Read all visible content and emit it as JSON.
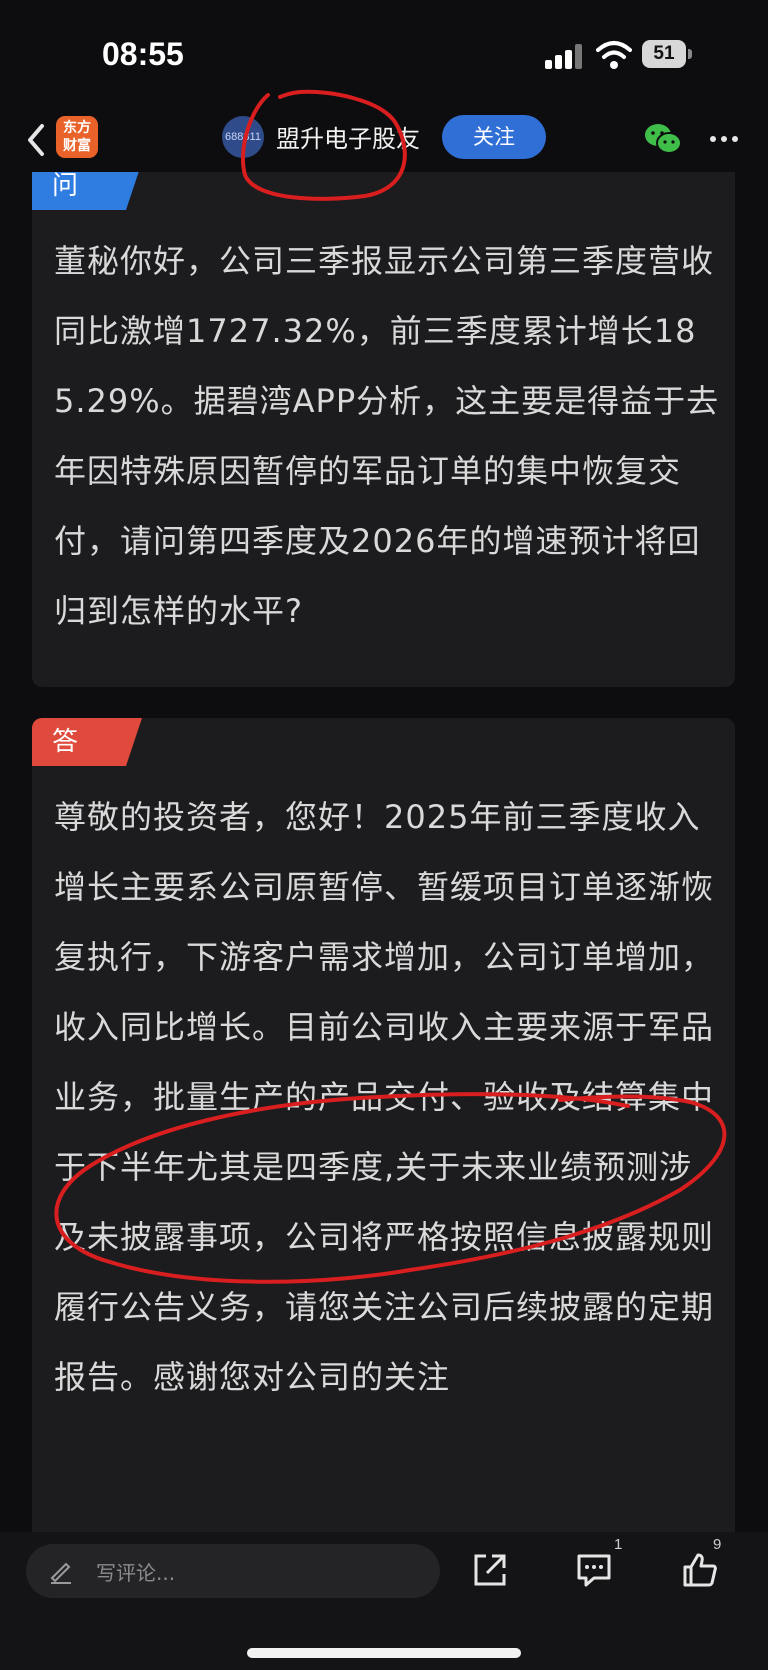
{
  "status_bar": {
    "time": "08:55",
    "battery": "51"
  },
  "header": {
    "app_logo_text": "东方\n财富",
    "stock_code_avatar": "688311",
    "stock_name": "盟升电子股友",
    "follow_label": "关注"
  },
  "question": {
    "tag": "问",
    "text": "董秘你好，公司三季报显示公司第三季度营收同比激增1727.32%，前三季度累计增长185.29%。据碧湾APP分析，这主要是得益于去年因特殊原因暂停的军品订单的集中恢复交付，请问第四季度及2026年的增速预计将回归到怎样的水平?"
  },
  "answer": {
    "tag": "答",
    "text": "尊敬的投资者，您好！2025年前三季度收入增长主要系公司原暂停、暂缓项目订单逐渐恢复执行，下游客户需求增加，公司订单增加，收入同比增长。目前公司收入主要来源于军品业务，批量生产的产品交付、验收及结算集中于下半年尤其是四季度,关于未来业绩预测涉及未披露事项，公司将严格按照信息披露规则履行公告义务，请您关注公司后续披露的定期报告。感谢您对公司的关注"
  },
  "bottom_bar": {
    "comment_placeholder": "写评论...",
    "comment_count": "1",
    "like_count": "9"
  },
  "colors": {
    "question_tag": "#2f7de0",
    "answer_tag": "#e04a3c",
    "follow_button": "#2f6fd6",
    "annotation": "#d81e1e"
  }
}
